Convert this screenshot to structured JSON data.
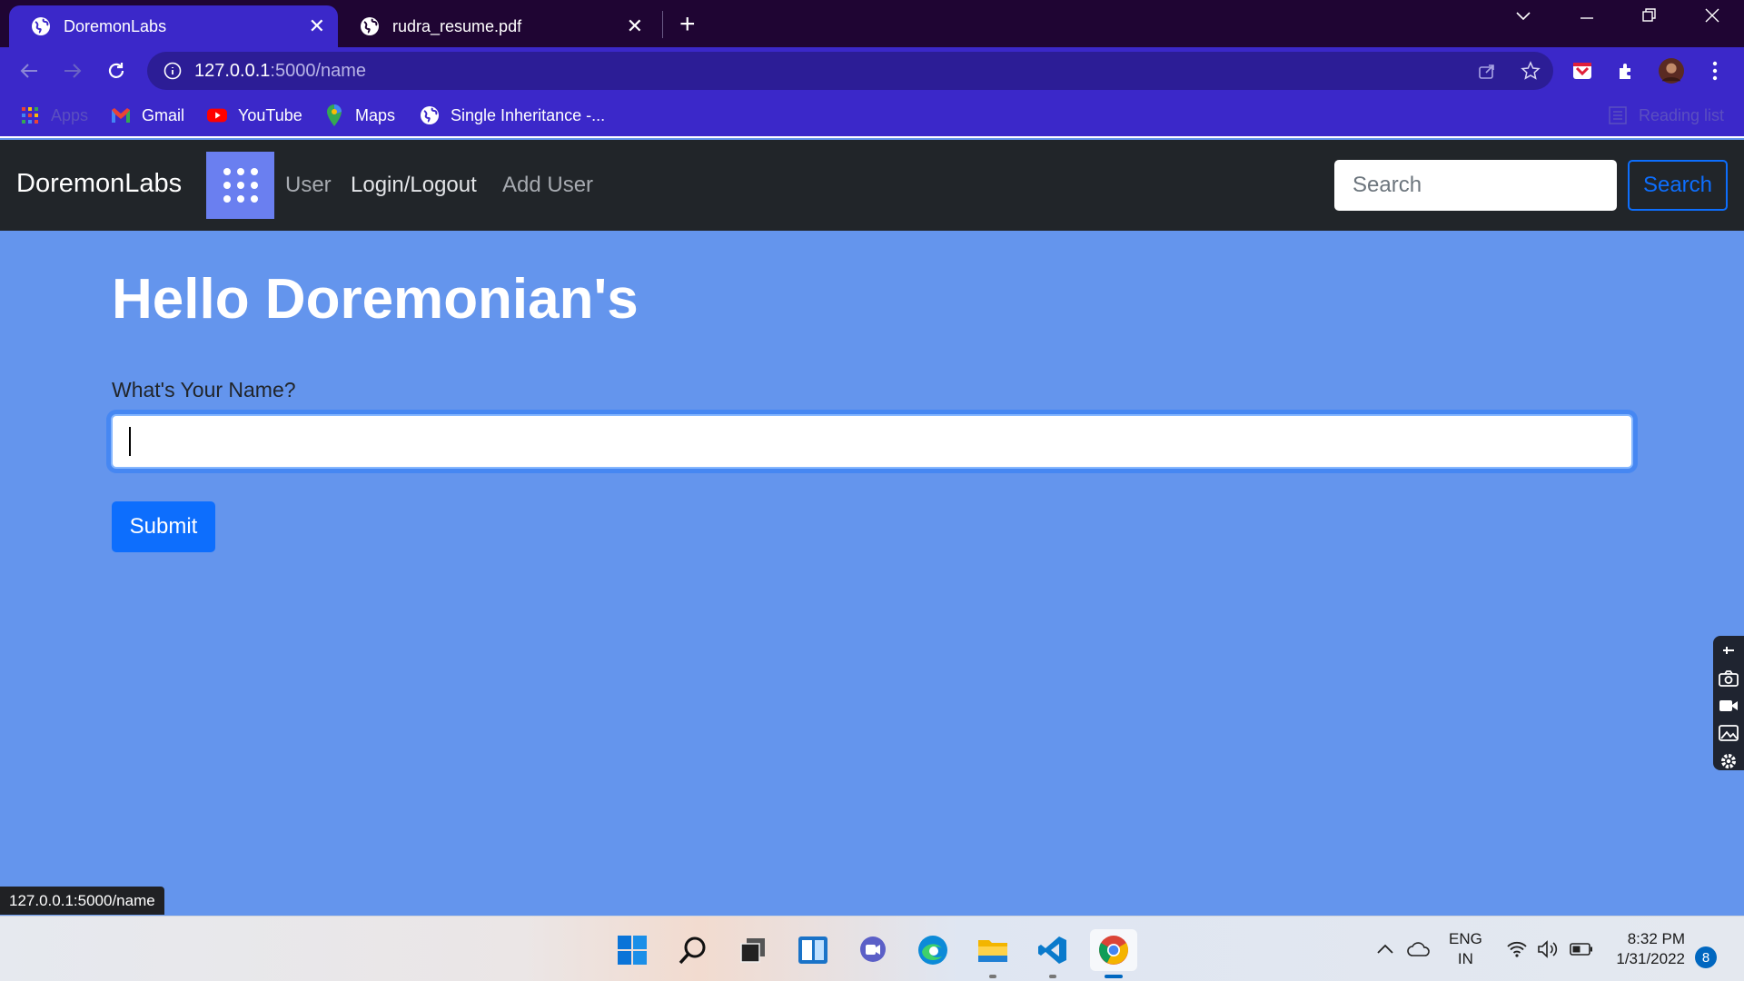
{
  "browser": {
    "tabs": [
      {
        "title": "DoremonLabs",
        "active": true
      },
      {
        "title": "rudra_resume.pdf",
        "active": false
      }
    ],
    "address": {
      "host": "127.0.0.1",
      "rest": ":5000/name"
    },
    "bookmarks": [
      {
        "label": "Apps",
        "icon": "apps-grid-icon"
      },
      {
        "label": "Gmail",
        "icon": "gmail-icon"
      },
      {
        "label": "YouTube",
        "icon": "youtube-icon"
      },
      {
        "label": "Maps",
        "icon": "maps-icon"
      },
      {
        "label": "Single Inheritance -...",
        "icon": "globe-icon"
      }
    ],
    "reading_list": "Reading list",
    "status_url": "127.0.0.1:5000/name"
  },
  "navbar": {
    "brand": "DoremonLabs",
    "links": [
      {
        "label": "User",
        "color": "#a6aab0"
      },
      {
        "label": "Login/Logout",
        "color": "#e3e5e8"
      },
      {
        "label": "Add User",
        "color": "#a6aab0"
      }
    ],
    "search_placeholder": "Search",
    "search_button": "Search"
  },
  "main": {
    "heading": "Hello Doremonian's",
    "field_label": "What's Your Name?",
    "name_value": "",
    "submit_label": "Submit"
  },
  "taskbar": {
    "language": {
      "line1": "ENG",
      "line2": "IN"
    },
    "time": "8:32 PM",
    "date": "1/31/2022",
    "notification_count": "8"
  },
  "colors": {
    "page_background": "#6495ed",
    "navbar_background": "#212529",
    "primary": "#0d6efd",
    "tab_strip": "#1f0533",
    "browser_toolbar": "#3b28c9"
  }
}
